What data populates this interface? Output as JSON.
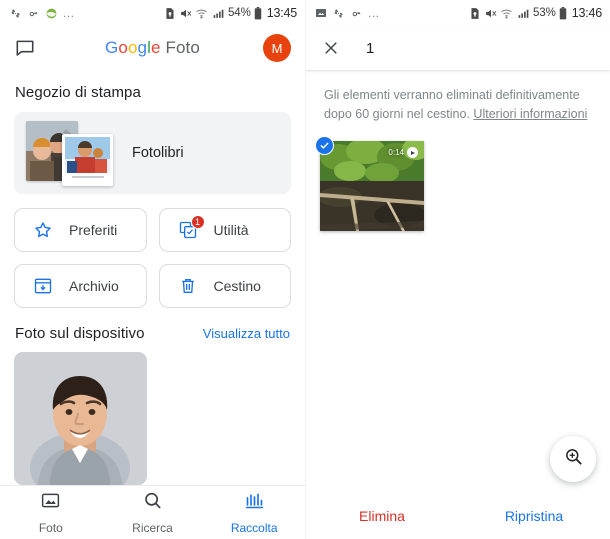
{
  "left": {
    "statusbar": {
      "notif_icons": [
        "fan-icon",
        "cloud-sync-icon",
        "app-green-icon"
      ],
      "overflow": "...",
      "sys_icons": [
        "sim-lock-icon",
        "mute-icon",
        "wifi-icon",
        "signal-icon"
      ],
      "battery_pct": "54%",
      "battery_icon": "battery-icon",
      "time": "13:45"
    },
    "appbar": {
      "chat_icon": "chat-bubble-icon",
      "brand": {
        "g1": "G",
        "o1": "o",
        "o2": "o",
        "g2": "g",
        "l1": "l",
        "e1": "e",
        "product": "Foto"
      },
      "avatar_initial": "M"
    },
    "print_store": {
      "title": "Negozio di stampa",
      "card_label": "Fotolibri"
    },
    "tiles": [
      {
        "label": "Preferiti",
        "icon": "star-outline-icon",
        "badge": null
      },
      {
        "label": "Utilità",
        "icon": "stacked-cards-icon",
        "badge": "1"
      },
      {
        "label": "Archivio",
        "icon": "archive-box-icon",
        "badge": null
      },
      {
        "label": "Cestino",
        "icon": "trash-icon",
        "badge": null
      }
    ],
    "device_photos": {
      "title": "Foto sul dispositivo",
      "view_all": "Visualizza tutto"
    },
    "bottomnav": [
      {
        "label": "Foto",
        "icon": "photo-icon",
        "active": false
      },
      {
        "label": "Ricerca",
        "icon": "search-icon",
        "active": false
      },
      {
        "label": "Raccolta",
        "icon": "library-icon",
        "active": true
      }
    ]
  },
  "right": {
    "statusbar": {
      "notif_icons": [
        "image-icon",
        "fan-icon",
        "cloud-sync-icon"
      ],
      "overflow": "...",
      "sys_icons": [
        "sim-lock-icon",
        "mute-icon",
        "wifi-icon",
        "signal-icon"
      ],
      "battery_pct": "53%",
      "battery_icon": "battery-icon",
      "time": "13:46"
    },
    "selection": {
      "close_icon": "close-icon",
      "count": "1"
    },
    "notice": {
      "text": "Gli elementi verranno eliminati definitivamente dopo 60 giorni nel cestino. ",
      "link": "Ulteriori informazioni"
    },
    "item": {
      "selected_icon": "check-icon",
      "duration": "0:14",
      "play_icon": "play-icon"
    },
    "fab": {
      "icon": "zoom-in-icon"
    },
    "actions": {
      "delete": "Elimina",
      "restore": "Ripristina"
    }
  },
  "colors": {
    "google_blue": "#4285F4",
    "google_red": "#EA4335",
    "google_yellow": "#FBBC05",
    "google_green": "#34A853",
    "link_blue": "#1a73e8",
    "danger_red": "#d93025",
    "avatar_orange": "#e8430f"
  }
}
